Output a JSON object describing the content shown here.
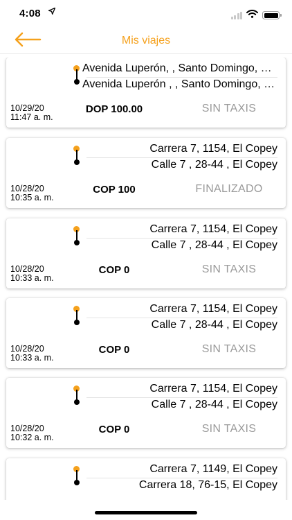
{
  "status_bar": {
    "time": "4:08",
    "location_arrow": "location-arrow-icon",
    "icons": [
      "signal-icon",
      "wifi-icon",
      "battery-icon"
    ]
  },
  "nav": {
    "title": "Mis viajes",
    "back_icon": "back-arrow-icon",
    "accent_color": "#f5a11d"
  },
  "trips": [
    {
      "from": "Avenida Luperón, , Santo Domingo, República Dominicana",
      "to": "Avenida Luperón ,  , Santo Domingo, República Dominicana",
      "date": "10/29/20",
      "time": "11:47 a. m.",
      "price": "DOP 100.00",
      "status": "SIN TAXIS"
    },
    {
      "from": "Carrera 7, 1154, El Copey",
      "to": "Calle 7 , 28-44 , El Copey",
      "date": "10/28/20",
      "time": "10:35 a. m.",
      "price": "COP 100",
      "status": "FINALIZADO"
    },
    {
      "from": "Carrera 7, 1154, El Copey",
      "to": "Calle 7 , 28-44 , El Copey",
      "date": "10/28/20",
      "time": "10:33 a. m.",
      "price": "COP 0",
      "status": "SIN TAXIS"
    },
    {
      "from": "Carrera 7, 1154, El Copey",
      "to": "Calle 7 , 28-44 , El Copey",
      "date": "10/28/20",
      "time": "10:33 a. m.",
      "price": "COP 0",
      "status": "SIN TAXIS"
    },
    {
      "from": "Carrera 7, 1154, El Copey",
      "to": "Calle 7 , 28-44 , El Copey",
      "date": "10/28/20",
      "time": "10:32 a. m.",
      "price": "COP 0",
      "status": "SIN TAXIS"
    },
    {
      "from": "Carrera 7, 1149, El Copey",
      "to": "Carrera 18, 76-15, El Copey",
      "date": "",
      "time": "",
      "price": "",
      "status": ""
    }
  ]
}
